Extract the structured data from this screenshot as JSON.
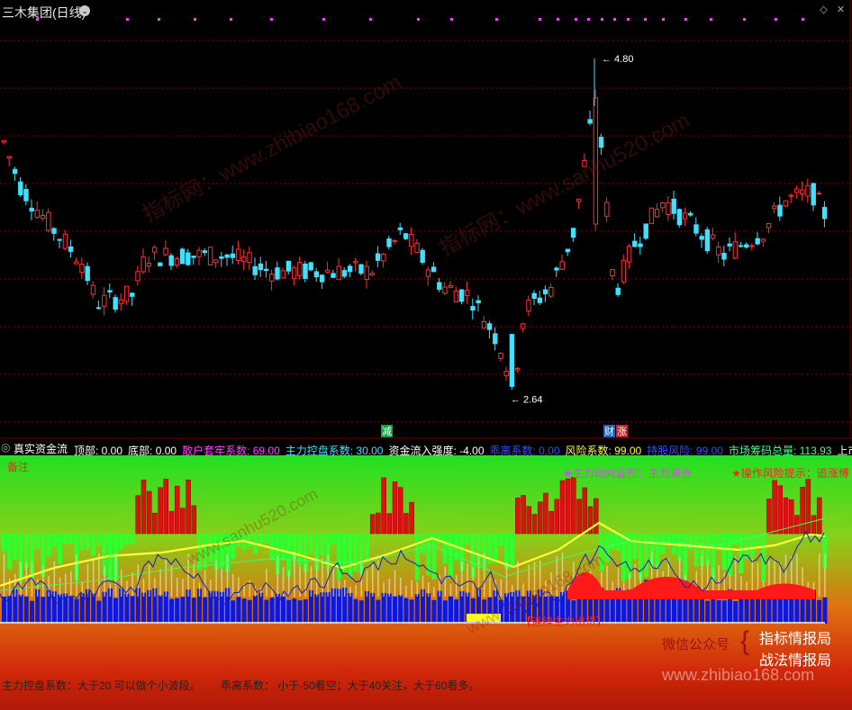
{
  "window": {
    "title": "三木集团(日线)"
  },
  "price_chart": {
    "type": "candlestick",
    "high_label": "4.80",
    "low_label": "2.64",
    "ymin": 2.5,
    "ymax": 5.0,
    "markers": [
      "减",
      "财",
      "涨"
    ]
  },
  "indicator_bar": {
    "name": "真实资金流",
    "items": [
      {
        "label": "顶部:",
        "value": "0.00",
        "color": "#ffffff"
      },
      {
        "label": "底部:",
        "value": "0.00",
        "color": "#ffffff"
      },
      {
        "label": "散户套牢系数:",
        "value": "69.00",
        "color": "#ff40ff"
      },
      {
        "label": "主力控盘系数:",
        "value": "30.00",
        "color": "#40e0ff"
      },
      {
        "label": "资金流入强度:",
        "value": "-4.00",
        "color": "#ffffff"
      },
      {
        "label": "乖离系数:",
        "value": "0.00",
        "color": "#3050ff"
      },
      {
        "label": "风险系数:",
        "value": "99.00",
        "color": "#ffff40"
      },
      {
        "label": "持股风险:",
        "value": "99.00",
        "color": "#3050ff"
      },
      {
        "label": "市场筹码总量:",
        "value": "113.93",
        "color": "#40ff80"
      },
      {
        "label": "上市",
        "value": "",
        "color": "#ffffff"
      }
    ]
  },
  "lower_panel": {
    "remark": "备注",
    "monitor_text": "★主力动向监控：主力减仓",
    "risk_text": "★操作风险提示：追涨博",
    "signal_text": "【连续主力出货】",
    "promo_line1": "微信公众号",
    "promo_line2a": "指标情报局",
    "promo_line2b": "战法情报局"
  },
  "footer": {
    "left": "主力控盘系数：大于20 可以做个小波段。",
    "right": "乖离系数： 小于-50看空；大于40关注，大于60看多。"
  },
  "watermarks": {
    "site1": "www.zhibiao168.com",
    "site2": "www.sanhu520.com",
    "site1_prefix": "指标网：",
    "site2_prefix": "指标网："
  },
  "colors": {
    "up": "#ff3030",
    "down": "#40e0ff",
    "grid": "#8b0000",
    "accent_magenta": "#ff40ff",
    "accent_yellow": "#ffff40"
  },
  "icons": [
    "collapse-icon",
    "diamond-icon",
    "close-icon"
  ]
}
